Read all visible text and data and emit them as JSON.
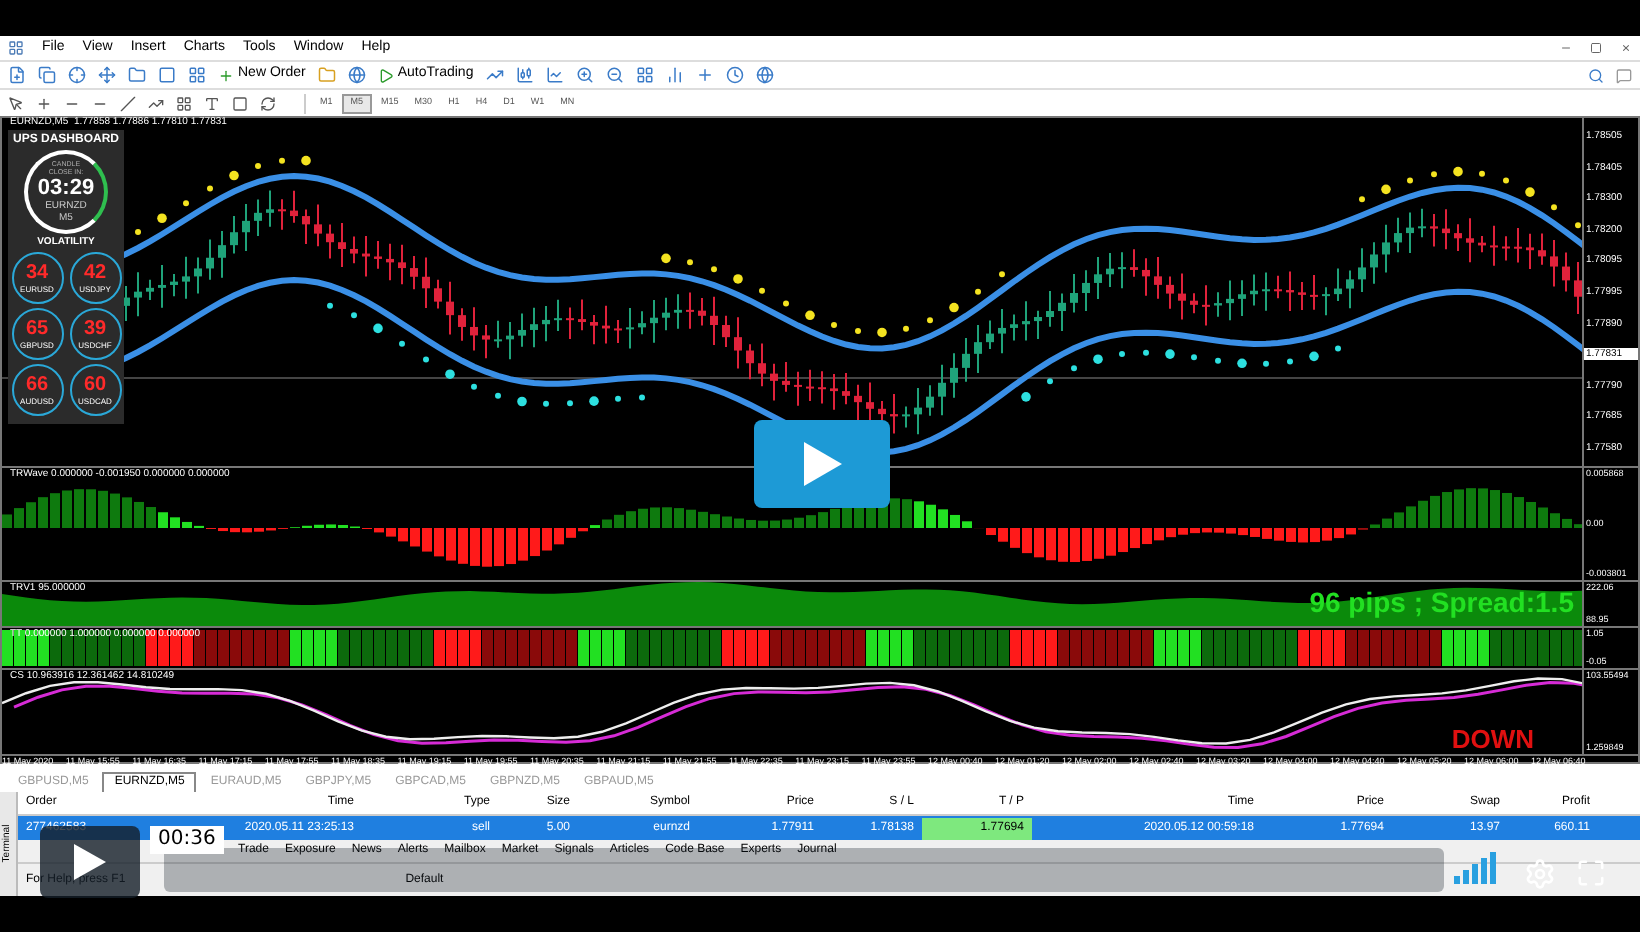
{
  "menu": [
    "File",
    "View",
    "Insert",
    "Charts",
    "Tools",
    "Window",
    "Help"
  ],
  "toolbar": {
    "new_order": "New Order",
    "auto_trading": "AutoTrading"
  },
  "timeframes": [
    {
      "label": "M1",
      "selected": false
    },
    {
      "label": "M5",
      "selected": true
    },
    {
      "label": "M15",
      "selected": false
    },
    {
      "label": "M30",
      "selected": false
    },
    {
      "label": "H1",
      "selected": false
    },
    {
      "label": "H4",
      "selected": false
    },
    {
      "label": "D1",
      "selected": false
    },
    {
      "label": "W1",
      "selected": false
    },
    {
      "label": "MN",
      "selected": false
    }
  ],
  "chart": {
    "header": "EURNZD,M5  1.77858 1.77886 1.77810 1.77831",
    "price_axis": [
      {
        "label": "1.78505",
        "kind": "tick"
      },
      {
        "label": "1.78405",
        "kind": "tick"
      },
      {
        "label": "1.78300",
        "kind": "tick"
      },
      {
        "label": "1.78200",
        "kind": "tick"
      },
      {
        "label": "1.78095",
        "kind": "tick"
      },
      {
        "label": "1.77995",
        "kind": "tick"
      },
      {
        "label": "1.77890",
        "kind": "tick"
      },
      {
        "label": "1.77831",
        "kind": "current"
      },
      {
        "label": "1.77790",
        "kind": "tick"
      },
      {
        "label": "1.77685",
        "kind": "tick"
      },
      {
        "label": "1.77580",
        "kind": "tick"
      }
    ],
    "dashboard": {
      "title": "UPS DASHBOARD",
      "countdown_caption": "CANDLE CLOSE IN:",
      "countdown": "03:29",
      "symbol": "EURNZD M5",
      "volatility_title": "VOLATILITY",
      "pairs": [
        {
          "value": "34",
          "symbol": "EURUSD"
        },
        {
          "value": "42",
          "symbol": "USDJPY"
        },
        {
          "value": "65",
          "symbol": "GBPUSD"
        },
        {
          "value": "39",
          "symbol": "USDCHF"
        },
        {
          "value": "66",
          "symbol": "AUDUSD"
        },
        {
          "value": "60",
          "symbol": "USDCAD"
        }
      ]
    },
    "indicators": [
      {
        "kind": "wave",
        "label": "TRWave 0.000000 -0.001950 0.000000 0.000000",
        "axis": [
          "0.005868",
          "0.00",
          "-0.003801"
        ]
      },
      {
        "kind": "area",
        "label": "TRV1 95.000000",
        "axis": [
          "222.06",
          "88.95"
        ],
        "note": "96 pips ; Spread:1.5"
      },
      {
        "kind": "strip",
        "label": "TT 0.000000 1.000000 0.000000 0.000000",
        "axis": [
          "1.05",
          "-0.05"
        ]
      },
      {
        "kind": "lines",
        "label": "CS 10.963916 12.361462 14.810249",
        "axis": [
          "103.55494",
          "1.259849"
        ],
        "note": "DOWN"
      }
    ],
    "time_axis": [
      "11 May 2020",
      "11 May 15:55",
      "11 May 16:35",
      "11 May 17:15",
      "11 May 17:55",
      "11 May 18:35",
      "11 May 19:15",
      "11 May 19:55",
      "11 May 20:35",
      "11 May 21:15",
      "11 May 21:55",
      "11 May 22:35",
      "11 May 23:15",
      "11 May 23:55",
      "12 May 00:40",
      "12 May 01:20",
      "12 May 02:00",
      "12 May 02:40",
      "12 May 03:20",
      "12 May 04:00",
      "12 May 04:40",
      "12 May 05:20",
      "12 May 06:00",
      "12 May 06:40"
    ]
  },
  "symbol_tabs": [
    {
      "label": "GBPUSD,M5",
      "selected": false
    },
    {
      "label": "EURNZD,M5",
      "selected": true
    },
    {
      "label": "EURAUD,M5",
      "selected": false
    },
    {
      "label": "GBPJPY,M5",
      "selected": false
    },
    {
      "label": "GBPCAD,M5",
      "selected": false
    },
    {
      "label": "GBPNZD,M5",
      "selected": false
    },
    {
      "label": "GBPAUD,M5",
      "selected": false
    }
  ],
  "terminal": {
    "side_label": "Terminal",
    "columns": [
      "Order",
      "Time",
      "Type",
      "Size",
      "Symbol",
      "Price",
      "S / L",
      "T / P",
      "Time",
      "Price",
      "Swap",
      "Profit"
    ],
    "rows": [
      {
        "selected": true,
        "cells": [
          "277462583",
          "2020.05.11 23:25:13",
          "sell",
          "5.00",
          "eurnzd",
          "1.77911",
          "1.78138",
          "1.77694",
          "2020.05.12 00:59:18",
          "1.77694",
          "13.97",
          "660.11"
        ]
      }
    ],
    "tabs": [
      "Trade",
      "Exposure",
      "News",
      "Alerts",
      "Mailbox",
      "Market",
      "Signals",
      "Articles",
      "Code Base",
      "Experts",
      "Journal"
    ]
  },
  "status_bar": {
    "help": "For Help, press F1",
    "profile": "Default"
  },
  "video": {
    "time": "00:36"
  }
}
